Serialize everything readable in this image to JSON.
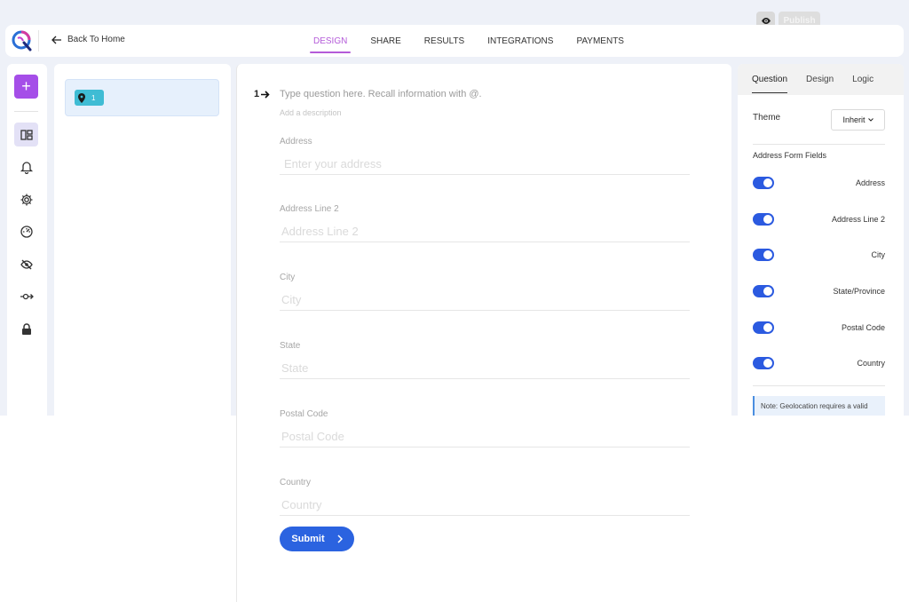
{
  "toolbar": {
    "preview_icon": "eye-icon",
    "publish_label": "Publish"
  },
  "header": {
    "logo_icon": "app-logo",
    "back_label": "Back To Home",
    "tabs": [
      {
        "label": "DESIGN",
        "active": true
      },
      {
        "label": "SHARE",
        "active": false
      },
      {
        "label": "RESULTS",
        "active": false
      },
      {
        "label": "INTEGRATIONS",
        "active": false
      },
      {
        "label": "PAYMENTS",
        "active": false
      }
    ]
  },
  "rail": {
    "add_label": "+",
    "icons": [
      "layout-icon",
      "bell-icon",
      "gear-icon",
      "speedometer-icon",
      "eye-off-icon",
      "logic-flow-icon",
      "lock-icon"
    ]
  },
  "questions": {
    "items": [
      {
        "icon": "map-pin-icon",
        "number": "1"
      }
    ]
  },
  "form": {
    "question_number": "1",
    "question_placeholder": "Type question here. Recall information with @.",
    "description_placeholder": "Add a description",
    "fields": [
      {
        "label": "Address",
        "placeholder": "Enter your address"
      },
      {
        "label": "Address Line 2",
        "placeholder": "Address Line 2"
      },
      {
        "label": "City",
        "placeholder": "City"
      },
      {
        "label": "State",
        "placeholder": "State"
      },
      {
        "label": "Postal Code",
        "placeholder": "Postal Code"
      },
      {
        "label": "Country",
        "placeholder": "Country"
      }
    ],
    "submit_label": "Submit"
  },
  "settings": {
    "tabs": [
      {
        "label": "Question",
        "active": true
      },
      {
        "label": "Design",
        "active": false
      },
      {
        "label": "Logic",
        "active": false
      }
    ],
    "theme_label": "Theme",
    "theme_value": "Inherit",
    "section_title": "Address Form Fields",
    "toggles": [
      {
        "label": "Address",
        "on": true
      },
      {
        "label": "Address Line 2",
        "on": true
      },
      {
        "label": "City",
        "on": true
      },
      {
        "label": "State/Province",
        "on": true
      },
      {
        "label": "Postal Code",
        "on": true
      },
      {
        "label": "Country",
        "on": true
      }
    ],
    "note": "Note: Geolocation requires a valid"
  },
  "colors": {
    "accent_purple": "#a54ee8",
    "active_tab": "#b45bd9",
    "primary_blue": "#2b63e0",
    "badge_teal": "#3fbcd4"
  }
}
